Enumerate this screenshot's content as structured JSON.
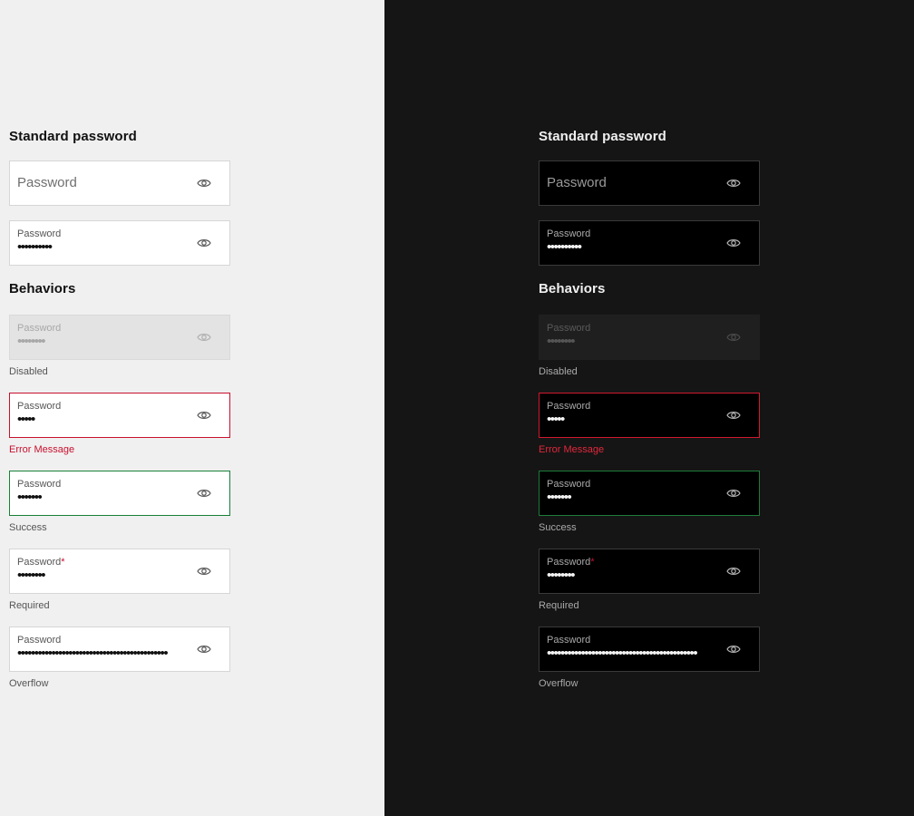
{
  "sections": {
    "standard_title": "Standard password",
    "behaviors_title": "Behaviors"
  },
  "fields": {
    "placeholder_field": {
      "placeholder": "Password"
    },
    "filled_field": {
      "label": "Password",
      "value": "••••••••••"
    },
    "disabled_field": {
      "label": "Password",
      "value": "••••••••",
      "helper": "Disabled"
    },
    "error_field": {
      "label": "Password",
      "value": "•••••",
      "helper": "Error Message"
    },
    "success_field": {
      "label": "Password",
      "value": "•••••••",
      "helper": "Success"
    },
    "required_field": {
      "label": "Password",
      "required_mark": "*",
      "value": "••••••••",
      "helper": "Required"
    },
    "overflow_field": {
      "label": "Password",
      "value": "••••••••••••••••••••••••••••••••••••••••••••",
      "helper": "Overflow"
    }
  },
  "icons": {
    "toggle_visibility": "eye-icon"
  },
  "colors": {
    "light_bg": "#f0f0f0",
    "dark_bg": "#151515",
    "error": "#c8102e",
    "success": "#188038"
  }
}
